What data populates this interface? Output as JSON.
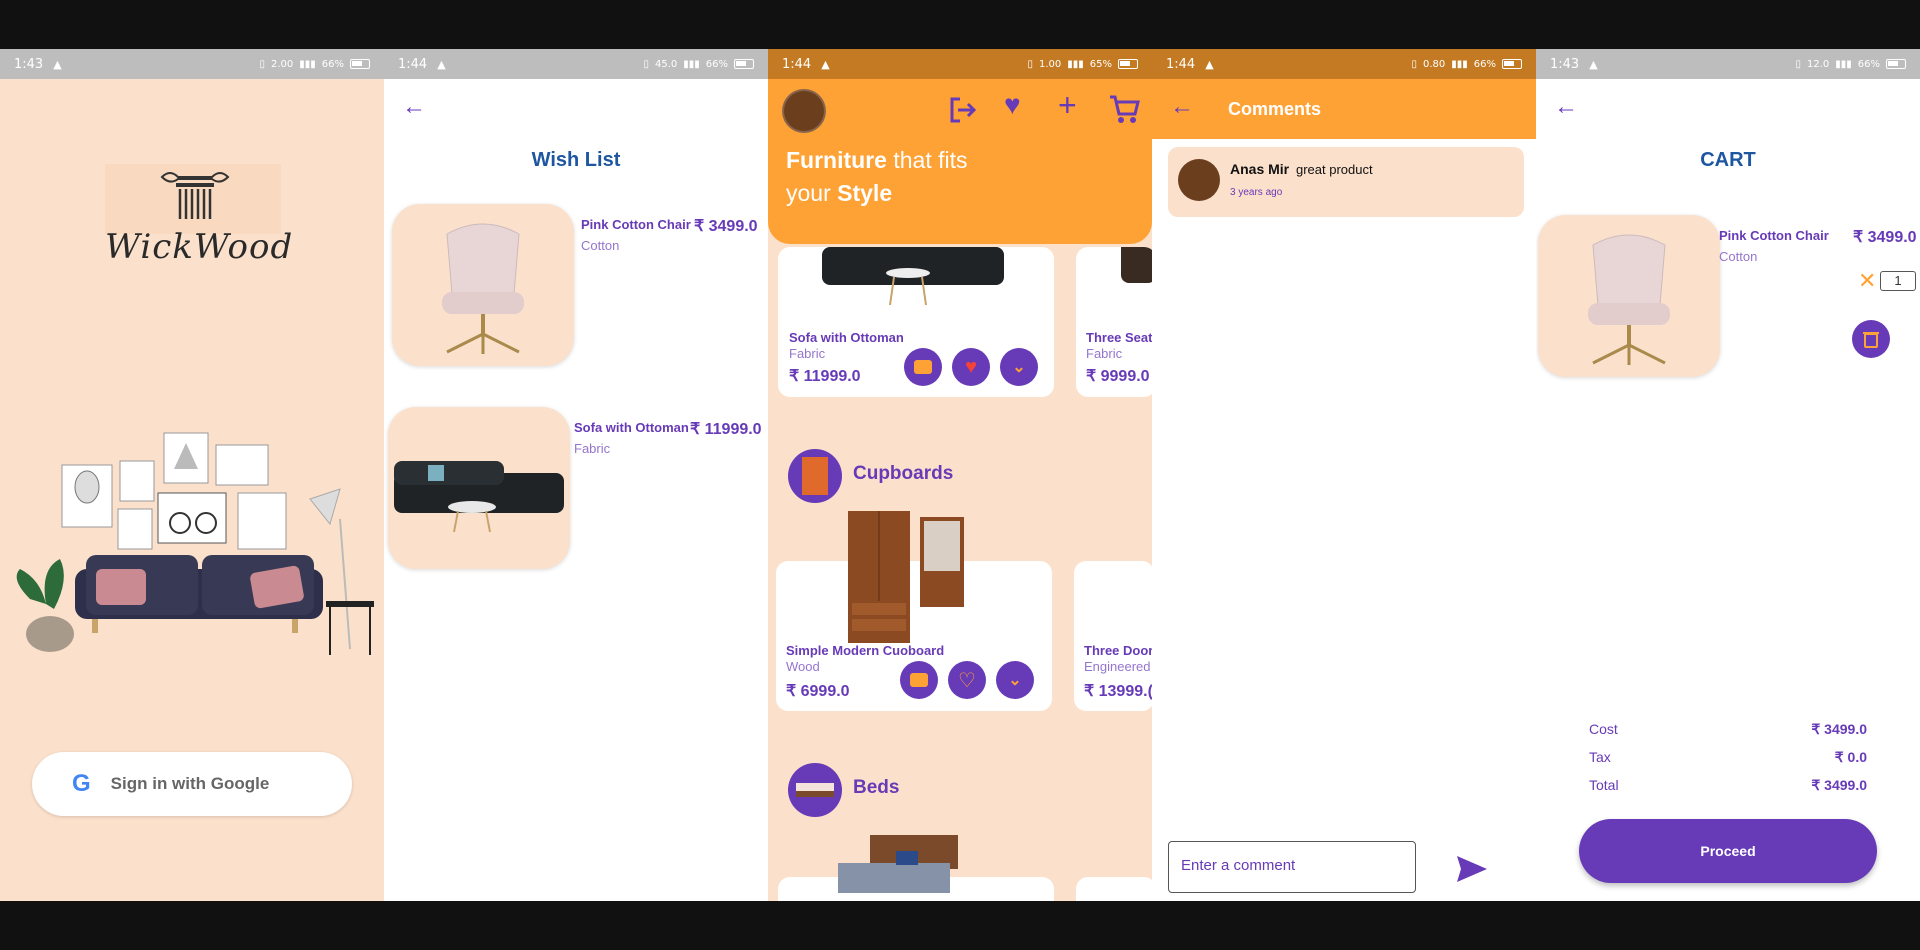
{
  "screens": {
    "login": {
      "status": {
        "time": "1:43",
        "speed": "2.00",
        "battery": "66%"
      },
      "brand": "WickWood",
      "google_button": "Sign in with Google",
      "google_glyph": "G"
    },
    "wishlist": {
      "status": {
        "time": "1:44",
        "speed": "45.0",
        "battery": "66%"
      },
      "title": "Wish List",
      "items": [
        {
          "name": "Pink Cotton Chair",
          "material": "Cotton",
          "price": "₹ 3499.0"
        },
        {
          "name": "Sofa with Ottoman",
          "material": "Fabric",
          "price": "₹ 11999.0"
        }
      ]
    },
    "home": {
      "status": {
        "time": "1:44",
        "speed": "1.00",
        "battery": "65%"
      },
      "headline_a": "Furniture",
      "headline_b": " that fits",
      "headline_c": "your ",
      "headline_d": "Style",
      "sofa_row": [
        {
          "name": "Sofa with Ottoman",
          "material": "Fabric",
          "price": "₹ 11999.0"
        },
        {
          "name": "Three Seat",
          "material": "Fabric",
          "price": "₹ 9999.0"
        }
      ],
      "categories": [
        {
          "label": "Cupboards"
        },
        {
          "label": "Beds"
        }
      ],
      "cupboard_row": [
        {
          "name": "Simple Modern Cuoboard",
          "material": "Wood",
          "price": "₹ 6999.0"
        },
        {
          "name": "Three Door",
          "material": "Engineered",
          "price": "₹ 13999.("
        }
      ]
    },
    "comments": {
      "status": {
        "time": "1:44",
        "speed": "0.80",
        "battery": "66%"
      },
      "title": "Comments",
      "comment": {
        "author": "Anas Mir",
        "text": "great product",
        "time": "3 years ago"
      },
      "input_placeholder": "Enter a comment"
    },
    "cart": {
      "status": {
        "time": "1:43",
        "speed": "12.0",
        "battery": "66%"
      },
      "title": "CART",
      "item": {
        "name": "Pink Cotton Chair",
        "material": "Cotton",
        "price": "₹ 3499.0",
        "qty": "1"
      },
      "summary": [
        {
          "label": "Cost",
          "value": "₹ 3499.0"
        },
        {
          "label": "Tax",
          "value": "₹ 0.0"
        },
        {
          "label": "Total",
          "value": "₹ 3499.0"
        }
      ],
      "proceed": "Proceed"
    }
  },
  "colors": {
    "peach": "#fbe0cb",
    "orange": "#ffa235",
    "purple": "#673ab7",
    "heart": "#f44336",
    "blue_title": "#1e56a0"
  }
}
